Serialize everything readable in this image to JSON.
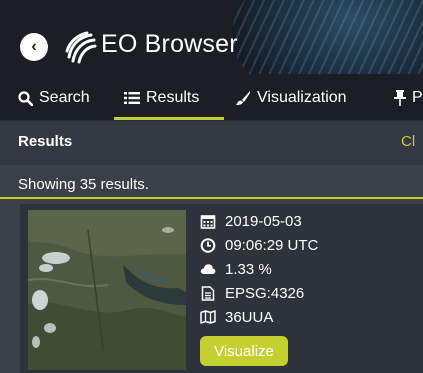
{
  "header": {
    "back_icon": "chevron-left-icon",
    "logo_icon": "sentinel-logo-icon",
    "title": "EO Browser"
  },
  "tabs": [
    {
      "label": "Search",
      "icon": "search-icon",
      "active": false
    },
    {
      "label": "Results",
      "icon": "list-icon",
      "active": true
    },
    {
      "label": "Visualization",
      "icon": "paintbrush-icon",
      "active": false
    },
    {
      "label": "P",
      "icon": "pin-icon",
      "active": false
    }
  ],
  "results": {
    "heading": "Results",
    "clear_label": "Cl",
    "count_text": "Showing 35 results."
  },
  "result_card": {
    "date": "2019-05-03",
    "time": "09:06:29 UTC",
    "cloud_cover": "1.33 %",
    "crs": "EPSG:4326",
    "tile": "36UUA",
    "visualize_label": "Visualize"
  },
  "colors": {
    "accent": "#c4cf30",
    "header_bg": "#1c1e25",
    "panel_bg": "#3b3f4a"
  }
}
